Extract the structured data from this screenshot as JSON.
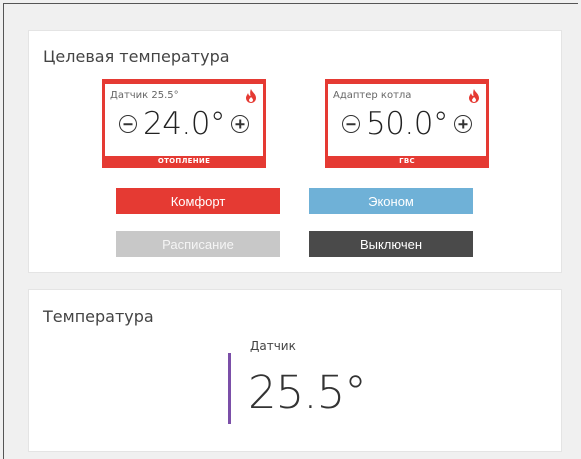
{
  "target_card": {
    "title": "Целевая температура",
    "heating_dial": {
      "label": "Датчик 25.5°",
      "value": "24.0°",
      "mode": "ОТОПЛЕНИЕ",
      "icon": "flame-icon"
    },
    "water_dial": {
      "label": "Адаптер котла",
      "value": "50.0°",
      "mode": "ГВС",
      "icon": "flame-icon"
    },
    "modes": {
      "comfort": "Комфорт",
      "econom": "Эконом",
      "schedule": "Расписание",
      "off": "Выключен"
    }
  },
  "temperature_card": {
    "title": "Температура",
    "sensor_label": "Датчик",
    "sensor_value": "25.5°"
  },
  "colors": {
    "accent_red": "#e53a33",
    "econom_blue": "#6fb1d7",
    "schedule_gray": "#c8c8c8",
    "off_dark": "#4a4a4a",
    "sensor_purple": "#7b4fa8"
  }
}
